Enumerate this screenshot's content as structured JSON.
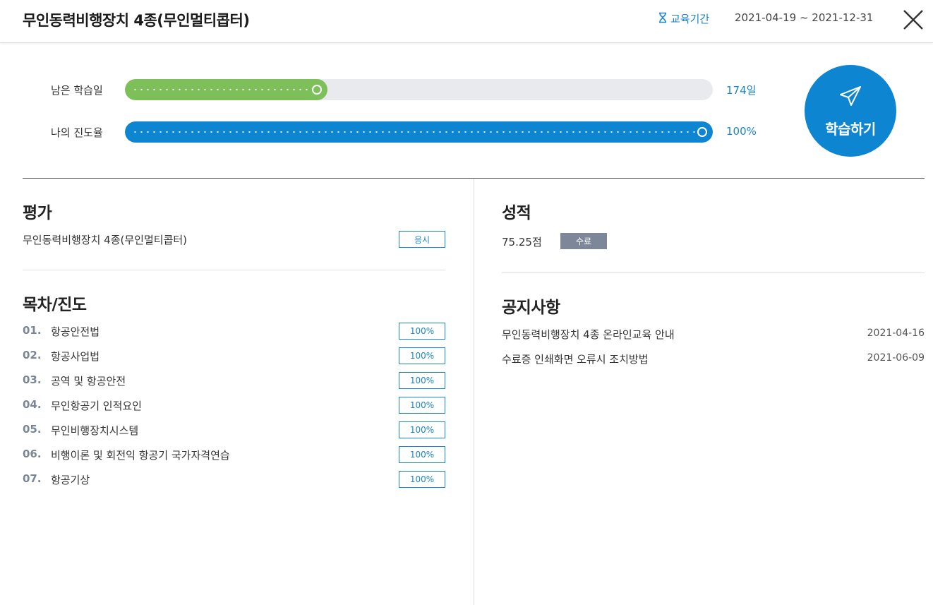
{
  "header": {
    "title": "무인동력비행장치 4종(무인멀티콥터)",
    "period_label": "교육기간",
    "period_value": "2021-04-19 ~ 2021-12-31"
  },
  "progress": {
    "remaining": {
      "label": "남은 학습일",
      "value_text": "174일",
      "fill_fraction": 0.344,
      "color": "#7dc05a"
    },
    "my_progress": {
      "label": "나의 진도율",
      "value_text": "100%",
      "fill_fraction": 1.0,
      "color": "#0e85d1"
    }
  },
  "study_button": {
    "label": "학습하기",
    "icon": "paper-plane-icon"
  },
  "evaluation": {
    "title": "평가",
    "item_name": "무인동력비행장치 4종(무인멀티콥터)",
    "button_label": "응시"
  },
  "toc": {
    "title": "목차/진도",
    "items": [
      {
        "num": "01.",
        "title": "항공안전법",
        "progress": "100%"
      },
      {
        "num": "02.",
        "title": "항공사업법",
        "progress": "100%"
      },
      {
        "num": "03.",
        "title": "공역 및 항공안전",
        "progress": "100%"
      },
      {
        "num": "04.",
        "title": "무인항공기 인적요인",
        "progress": "100%"
      },
      {
        "num": "05.",
        "title": "무인비행장치시스템",
        "progress": "100%"
      },
      {
        "num": "06.",
        "title": "비행이론 및 회전익 항공기 국가자격연습",
        "progress": "100%"
      },
      {
        "num": "07.",
        "title": "항공기상",
        "progress": "100%"
      }
    ]
  },
  "grade": {
    "title": "성적",
    "score": "75.25점",
    "status": "수료"
  },
  "notices": {
    "title": "공지사항",
    "items": [
      {
        "title": "무인동력비행장치 4종 온라인교육 안내",
        "date": "2021-04-16"
      },
      {
        "title": "수료증 인쇄화면 오류시 조치방법",
        "date": "2021-06-09"
      }
    ]
  },
  "colors": {
    "accent": "#1a85c8",
    "primary_button": "#0e85d1",
    "green": "#7dc05a",
    "badge_gray": "#7d8799"
  }
}
